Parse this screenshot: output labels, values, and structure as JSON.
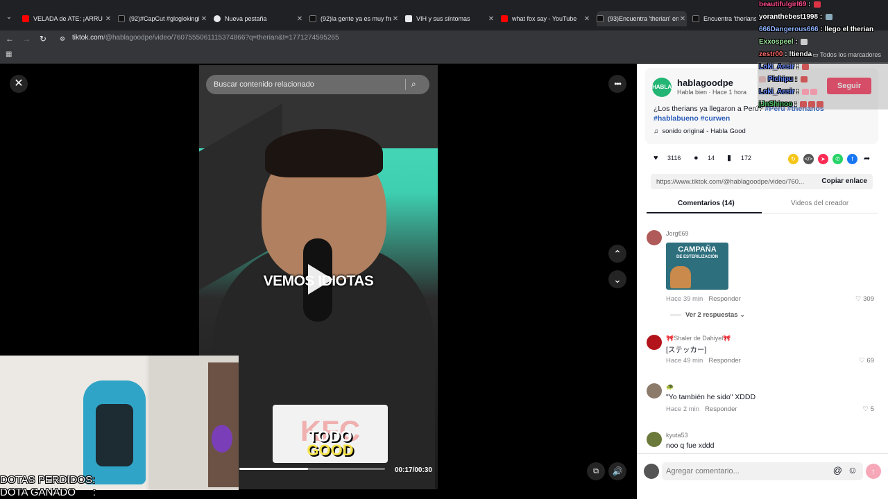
{
  "browser": {
    "tabs": [
      {
        "title": "VELADA de ATE: ¡ARRU",
        "fav_color": "#ff0000"
      },
      {
        "title": "(92)#CapCut #gloglokingi",
        "fav_color": "#111111"
      },
      {
        "title": "Nueva pestaña",
        "fav_color": "#e8eaed"
      },
      {
        "title": "(92)la gente ya es muy fre",
        "fav_color": "#111111"
      },
      {
        "title": "VIH y sus síntomas",
        "fav_color": "#e8eaed"
      },
      {
        "title": "what fox say - YouTube",
        "fav_color": "#ff0000"
      },
      {
        "title": "(93)Encuentra 'therian' en",
        "fav_color": "#111111"
      },
      {
        "title": "Encuentra 'therians en",
        "fav_color": "#111111"
      }
    ],
    "url_host": "tiktok.com",
    "url_path": "/@hablagoodpe/video/7607555061115374866?q=therian&t=1771274595265",
    "bookmarks_label": "Todos los marcadores"
  },
  "video": {
    "search_placeholder": "Buscar contenido relacionado",
    "caption": "VEMOS IDIOTAS",
    "card_bg_text": "KFC",
    "card_logo_top": "TODO",
    "card_logo_bottom": "GOOD",
    "time": "00:17/00:30",
    "progress": 0.47
  },
  "stream_overlay": {
    "line1": "DOTAS PERDIDOS:",
    "line2": "DOTA GANADO      :"
  },
  "post": {
    "avatar_text": "HABLA",
    "username": "hablagoodpe",
    "subline": "Habla bien · Hace 1 hora",
    "follow_label": "Seguir",
    "description_text": "¿Los therians ya llegaron a Perú? ",
    "tags": "#Perú #therianos",
    "tags_line2": "#hablabueno #curwen",
    "sound": "sonido original - Habla Good",
    "likes": "3116",
    "comments": "14",
    "saves": "172",
    "link": "https://www.tiktok.com/@hablagoodpe/video/760...",
    "copy_label": "Copiar enlace",
    "tab_comments": "Comentarios (14)",
    "tab_videos": "Videos del creador"
  },
  "comments": [
    {
      "user": "Jorg€69",
      "text": "",
      "time": "Hace 39 min",
      "reply": "Responder",
      "likes": "309",
      "avatar_color": "#b05a5a",
      "sticker_title": "CAMPAÑA",
      "sticker_sub": "DE ESTERILIZACIÓN"
    },
    {
      "user": "🎀Shaler de Dahiyel🎀",
      "text": "[ステッカー]",
      "time": "Hace 49 min",
      "reply": "Responder",
      "likes": "69",
      "avatar_color": "#b3141c"
    },
    {
      "user": "🐢",
      "text": "\"Yo también he sido\" XDDD",
      "time": "Hace 2 min",
      "reply": "Responder",
      "likes": "5",
      "avatar_color": "#8c7a6a"
    },
    {
      "user": "kyuta53",
      "text": "noo q fue xddd",
      "avatar_color": "#6b7a3a"
    }
  ],
  "view_replies": "Ver 2 respuestas",
  "comment_input_placeholder": "Agregar comentario...",
  "chat": [
    {
      "user": "beautifulgirl69",
      "user_color": "#ff4d8f",
      "msg": ""
    },
    {
      "user": "yoranthebest1998",
      "user_color": "#ffffff",
      "msg": ""
    },
    {
      "user": "666Dangerous666",
      "user_color": "#8fb4ff",
      "msg": "llego el therian"
    },
    {
      "user": "Exxospeel",
      "user_color": "#9be39b",
      "msg": ""
    },
    {
      "user": "zestr00",
      "user_color": "#ff6b6b",
      "msg": "!tienda"
    },
    {
      "user": "Loki_Aesir",
      "user_color": "#6a8cff",
      "msg": ""
    },
    {
      "user": "Pichipu",
      "user_color": "#6a8cff",
      "msg": ""
    },
    {
      "user": "Loki_Aesir",
      "user_color": "#6a8cff",
      "msg": ""
    },
    {
      "user": "jJnShinoo",
      "user_color": "#52c46a",
      "msg": ""
    }
  ]
}
